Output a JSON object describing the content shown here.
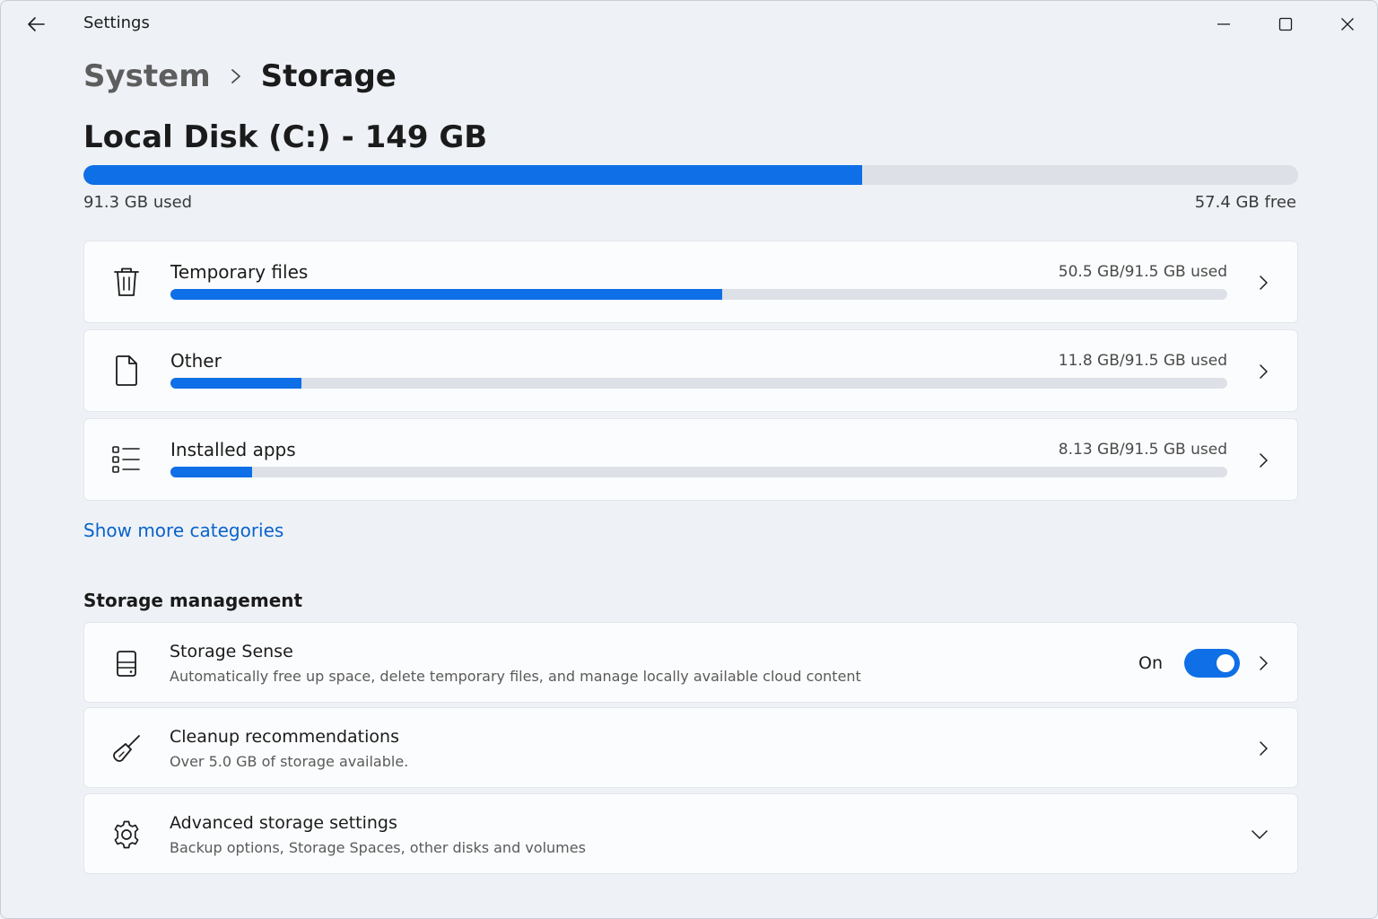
{
  "window": {
    "title": "Settings"
  },
  "breadcrumb": {
    "parent": "System",
    "current": "Storage"
  },
  "disk": {
    "title": "Local Disk (C:) - 149 GB",
    "used_label": "91.3 GB used",
    "free_label": "57.4 GB free",
    "used_fraction": 0.641
  },
  "categories": [
    {
      "name": "Temporary files",
      "size_label": "50.5 GB/91.5 GB used",
      "used_fraction": 0.522,
      "icon": "trash-icon"
    },
    {
      "name": "Other",
      "size_label": "11.8 GB/91.5 GB used",
      "used_fraction": 0.124,
      "icon": "file-icon"
    },
    {
      "name": "Installed apps",
      "size_label": "8.13 GB/91.5 GB used",
      "used_fraction": 0.077,
      "icon": "app-list-icon"
    }
  ],
  "show_more": "Show more categories",
  "management": {
    "section_title": "Storage management",
    "items": [
      {
        "title": "Storage Sense",
        "description": "Automatically free up space, delete temporary files, and manage locally available cloud content",
        "toggle_label": "On",
        "toggle_on": true,
        "icon": "drive-icon"
      },
      {
        "title": "Cleanup recommendations",
        "description": "Over 5.0 GB of storage available.",
        "icon": "broom-icon"
      },
      {
        "title": "Advanced storage settings",
        "description": "Backup options, Storage Spaces, other disks and volumes",
        "icon": "gear-icon"
      }
    ]
  },
  "colors": {
    "accent": "#0f6fe6",
    "link": "#0a63c9",
    "track": "#dde1e7",
    "card": "#fbfcfd",
    "background": "#eef2f7"
  }
}
